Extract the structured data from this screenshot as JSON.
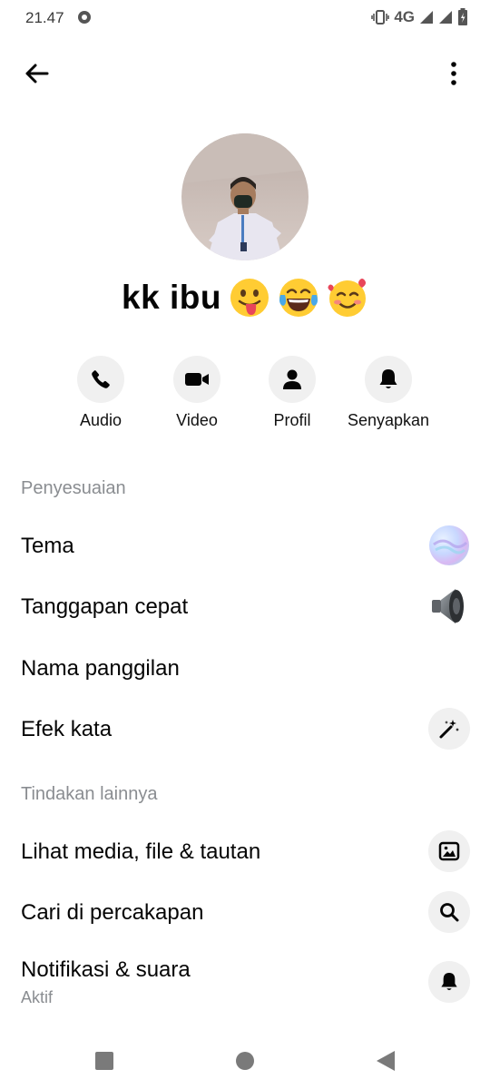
{
  "status_bar": {
    "time": "21.47",
    "network": "4G",
    "icons": [
      "app-notification-icon",
      "vibrate-icon",
      "signal-icon",
      "signal-icon",
      "battery-icon"
    ]
  },
  "top_nav": {
    "back_icon": "arrow-left-icon",
    "more_icon": "more-vertical-icon"
  },
  "profile": {
    "name": "kk ibu",
    "emojis": [
      "face-with-tongue",
      "face-with-tears-of-joy",
      "smiling-face-with-hearts"
    ]
  },
  "actions": [
    {
      "label": "Audio",
      "icon": "phone-icon"
    },
    {
      "label": "Video",
      "icon": "video-camera-icon"
    },
    {
      "label": "Profil",
      "icon": "person-icon"
    },
    {
      "label": "Senyapkan",
      "icon": "bell-icon"
    }
  ],
  "sections": {
    "customization": {
      "title": "Penyesuaian",
      "items": [
        {
          "label": "Tema",
          "icon": "theme-gradient-icon"
        },
        {
          "label": "Tanggapan cepat",
          "icon": "speaker-icon"
        },
        {
          "label": "Nama panggilan"
        },
        {
          "label": "Efek kata",
          "icon": "magic-wand-icon"
        }
      ]
    },
    "more_actions": {
      "title": "Tindakan lainnya",
      "items": [
        {
          "label": "Lihat media, file & tautan",
          "icon": "image-icon"
        },
        {
          "label": "Cari di percakapan",
          "icon": "search-icon"
        },
        {
          "label": "Notifikasi & suara",
          "sublabel": "Aktif",
          "icon": "bell-icon"
        }
      ]
    }
  },
  "colors": {
    "primary_text": "#050505",
    "secondary_text": "#8a8d91",
    "icon_background": "#f0f0f0"
  },
  "nav_bar": {
    "icons": [
      "recents-square-icon",
      "home-circle-icon",
      "back-triangle-icon"
    ]
  }
}
